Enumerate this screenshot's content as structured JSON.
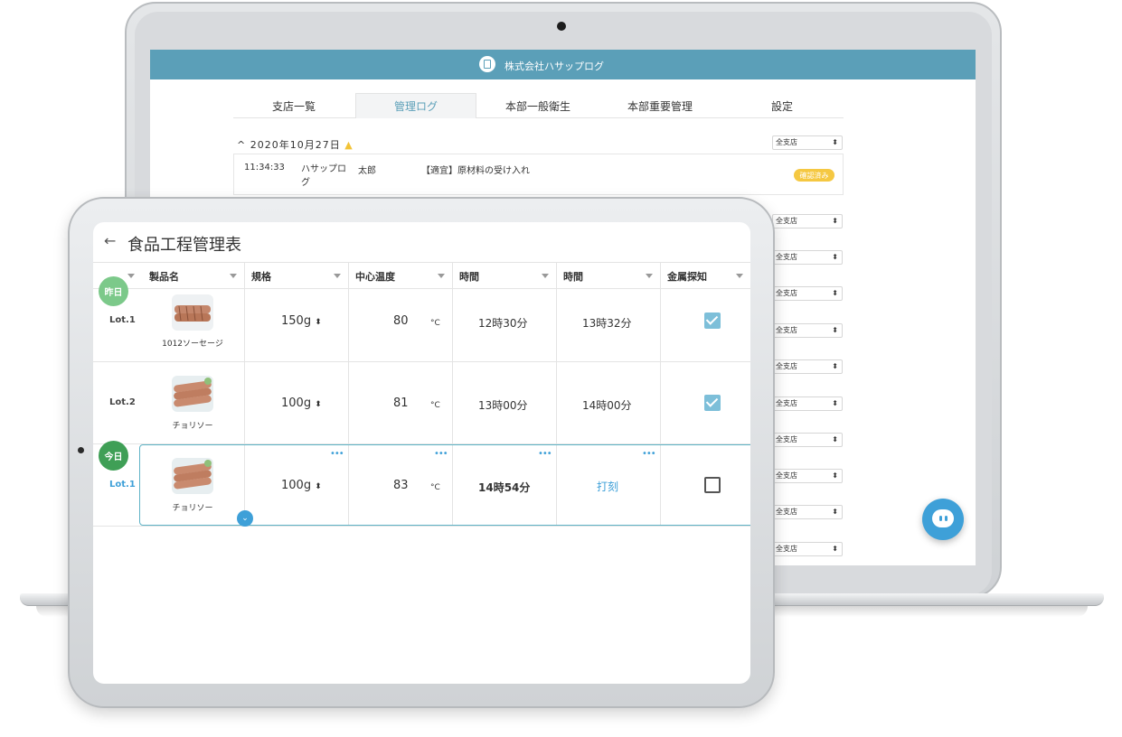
{
  "laptop": {
    "header": {
      "company": "株式会社ハサップログ"
    },
    "tabs": [
      "支店一覧",
      "管理ログ",
      "本部一般衛生",
      "本部重要管理",
      "設定"
    ],
    "active_tab": "管理ログ",
    "date": "2020年10月27日",
    "log_entry": {
      "time": "11:34:33",
      "user": "ハサップログ",
      "name": "太郎",
      "message": "【適宜】原材料の受け入れ",
      "badge": "確認済み"
    },
    "branch_select": "全支店"
  },
  "tablet": {
    "back": "←",
    "title": "食品工程管理表",
    "columns": [
      "製品名",
      "規格",
      "中心温度",
      "時間",
      "時間",
      "金属探知"
    ],
    "temp_unit": "°C",
    "rows": [
      {
        "lot": "Lot.1",
        "product": "1012ソーセージ",
        "spec": "150g",
        "temp": "80",
        "start": "12時30分",
        "end": "13時32分",
        "metal_check": true,
        "day_badge": "昨日"
      },
      {
        "lot": "Lot.2",
        "product": "チョリソー",
        "spec": "100g",
        "temp": "81",
        "start": "13時00分",
        "end": "14時00分",
        "metal_check": true
      },
      {
        "lot": "Lot.1",
        "product": "チョリソー",
        "spec": "100g",
        "temp": "83",
        "start": "14時54分",
        "end": "打刻",
        "metal_check": false,
        "day_badge": "今日"
      }
    ]
  },
  "colors": {
    "header": "#5b9fb8",
    "accent": "#3ea0d8",
    "yesterday_badge": "#7cc98a",
    "today_badge": "#3f9f56",
    "warning": "#f2c337"
  }
}
